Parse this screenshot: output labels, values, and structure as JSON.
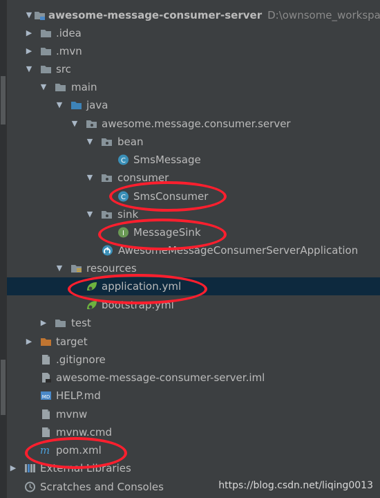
{
  "project_tree": {
    "items": [
      {
        "label": "awesome-message-consumer-server",
        "extra": "D:\\ownsome_workspace\\aw",
        "icon": "module-folder-icon",
        "arrow": "expanded"
      },
      {
        "label": ".idea",
        "icon": "folder-icon",
        "arrow": "collapsed"
      },
      {
        "label": ".mvn",
        "icon": "folder-icon",
        "arrow": "collapsed"
      },
      {
        "label": "src",
        "icon": "folder-icon",
        "arrow": "expanded"
      },
      {
        "label": "main",
        "icon": "folder-icon",
        "arrow": "expanded"
      },
      {
        "label": "java",
        "icon": "source-root-folder-icon",
        "arrow": "expanded"
      },
      {
        "label": "awesome.message.consumer.server",
        "icon": "package-icon",
        "arrow": "expanded"
      },
      {
        "label": "bean",
        "icon": "package-icon",
        "arrow": "expanded"
      },
      {
        "label": "SmsMessage",
        "icon": "class-icon"
      },
      {
        "label": "consumer",
        "icon": "package-icon",
        "arrow": "expanded"
      },
      {
        "label": "SmsConsumer",
        "icon": "class-icon"
      },
      {
        "label": "sink",
        "icon": "package-icon",
        "arrow": "expanded"
      },
      {
        "label": "MessageSink",
        "icon": "interface-icon"
      },
      {
        "label": "AwesomeMessageConsumerServerApplication",
        "icon": "spring-boot-class-icon"
      },
      {
        "label": "resources",
        "icon": "resources-folder-icon",
        "arrow": "expanded"
      },
      {
        "label": "application.yml",
        "icon": "spring-yml-icon"
      },
      {
        "label": "bootstrap.yml",
        "icon": "spring-yml-icon"
      },
      {
        "label": "test",
        "icon": "folder-icon",
        "arrow": "collapsed"
      },
      {
        "label": "target",
        "icon": "excluded-folder-icon",
        "arrow": "collapsed"
      },
      {
        "label": ".gitignore",
        "icon": "file-icon"
      },
      {
        "label": "awesome-message-consumer-server.iml",
        "icon": "iml-file-icon"
      },
      {
        "label": "HELP.md",
        "icon": "markdown-file-icon"
      },
      {
        "label": "mvnw",
        "icon": "file-icon"
      },
      {
        "label": "mvnw.cmd",
        "icon": "file-icon"
      },
      {
        "label": "pom.xml",
        "icon": "maven-icon"
      },
      {
        "label": "External Libraries",
        "icon": "libraries-icon",
        "arrow": "collapsed"
      },
      {
        "label": "Scratches and Consoles",
        "icon": "scratches-icon"
      }
    ],
    "selected": "application.yml"
  },
  "icon_glyphs": {
    "class": "C",
    "interface": "I",
    "markdown": "MD",
    "maven": "m"
  },
  "watermark": "https://blog.csdn.net/liqing0013",
  "colors": {
    "background": "#3c3f41",
    "selection": "#0d293e",
    "text": "#bbbbbb",
    "path_text": "#8a8a8a",
    "class_icon": "#3a8fb7",
    "interface_icon": "#6a9955",
    "spring_icon": "#6db33f",
    "annotation_ring": "#ff1f2e"
  }
}
